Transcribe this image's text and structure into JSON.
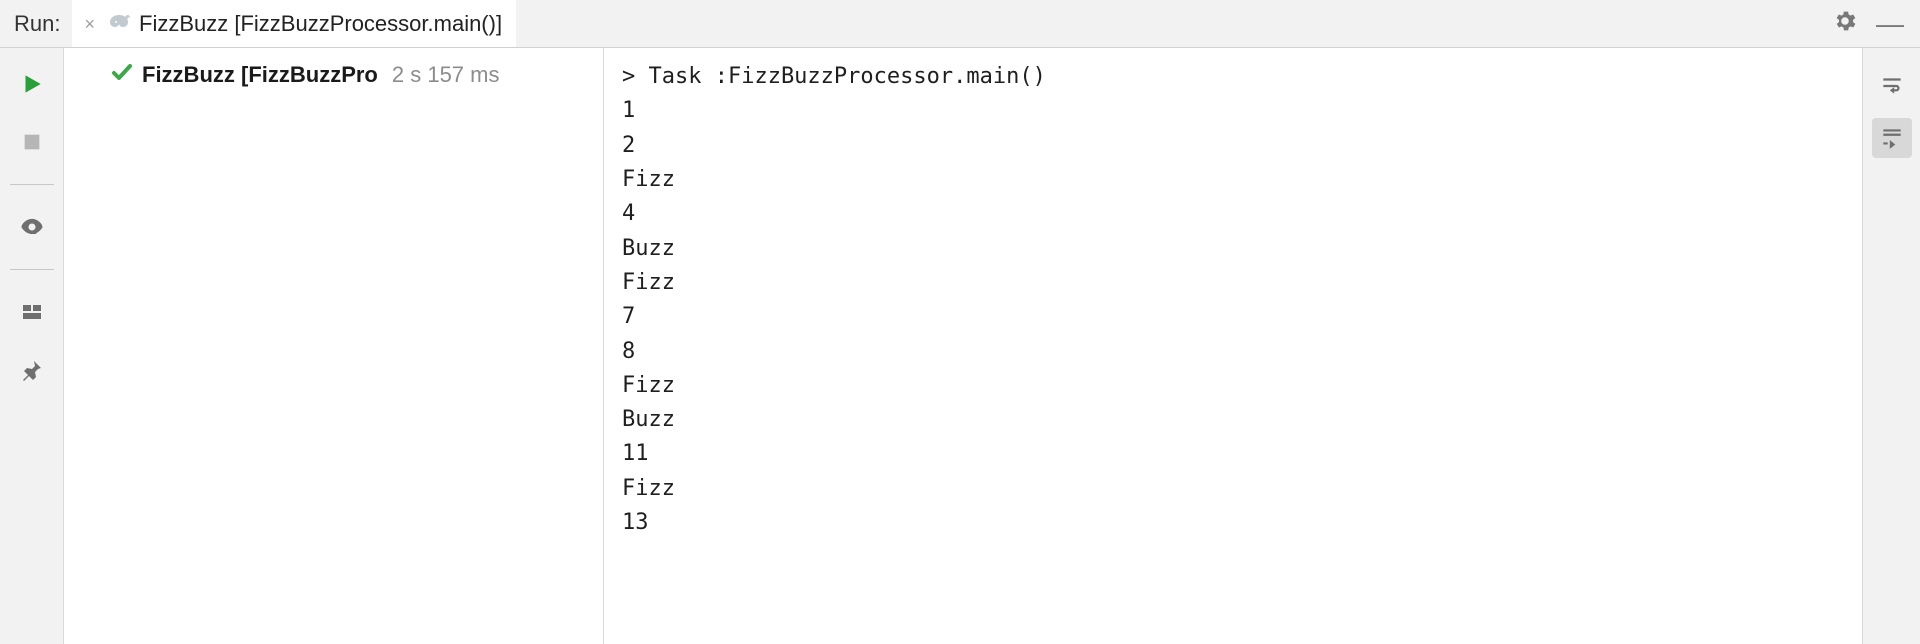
{
  "header": {
    "title": "Run:",
    "tab_label": "FizzBuzz [FizzBuzzProcessor.main()]"
  },
  "tree": {
    "item_label": "FizzBuzz [FizzBuzzPro",
    "item_time": "2 s 157 ms"
  },
  "console": {
    "task_line": "> Task :FizzBuzzProcessor.main()",
    "lines": [
      "1",
      "2",
      "Fizz",
      "4",
      "Buzz",
      "Fizz",
      "7",
      "8",
      "Fizz",
      "Buzz",
      "11",
      "Fizz",
      "13"
    ]
  },
  "icons": {
    "close": "×",
    "minimize": "—"
  }
}
